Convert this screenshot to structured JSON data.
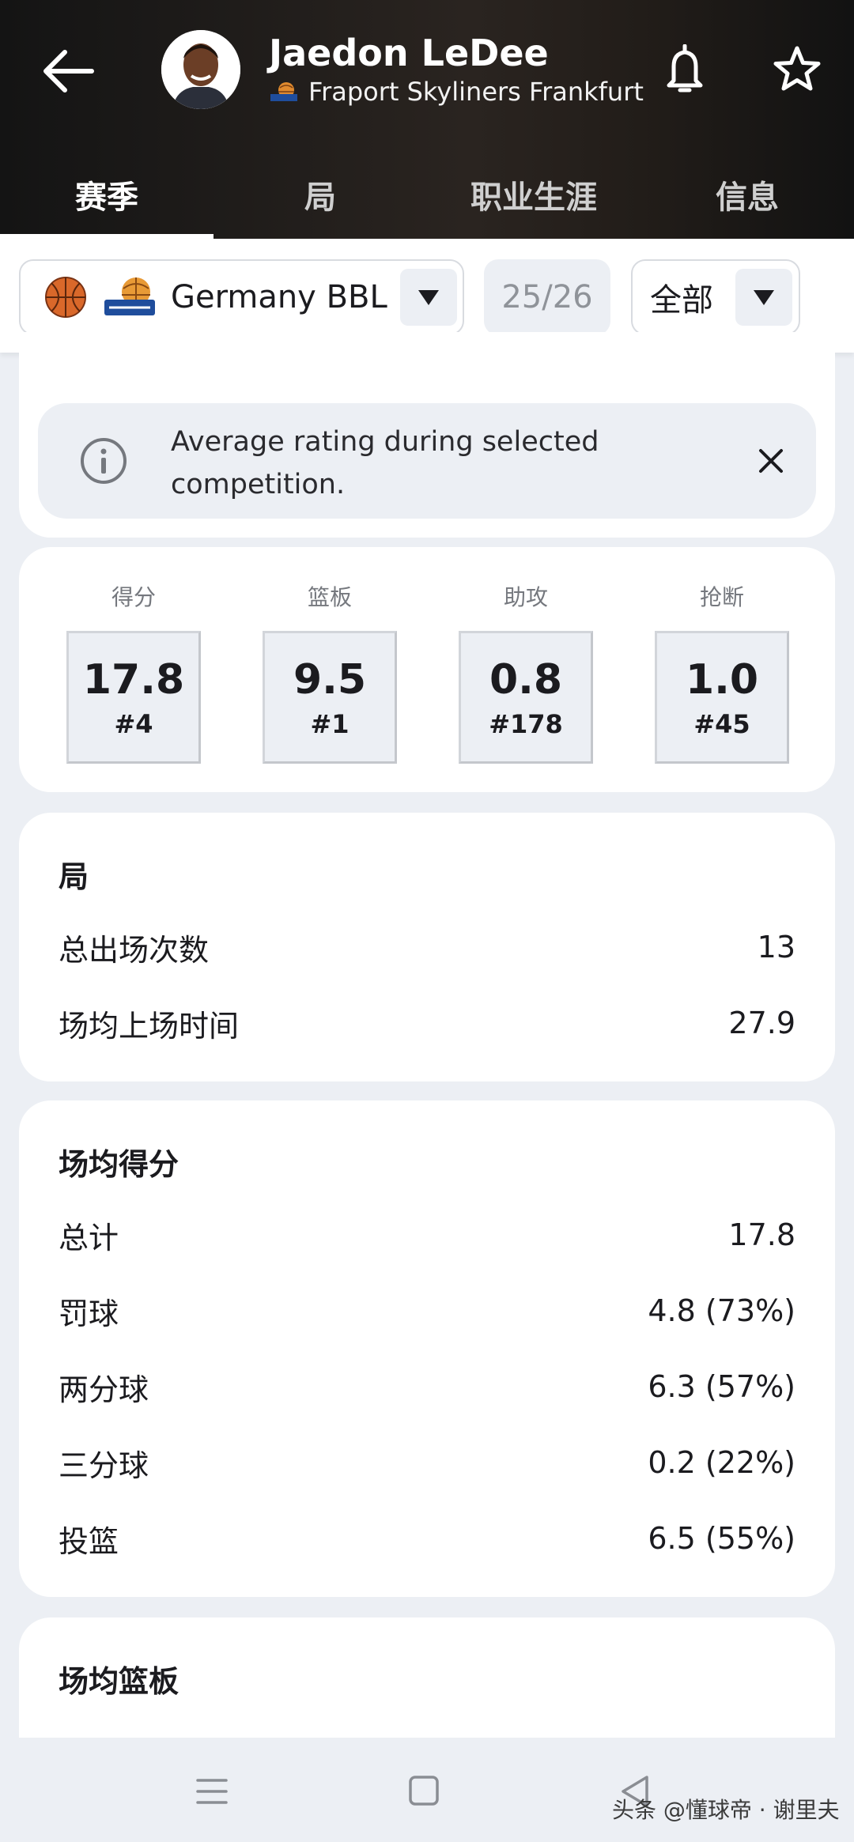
{
  "header": {
    "player_name": "Jaedon LeDee",
    "team_name": "Fraport Skyliners Frankfurt"
  },
  "tabs": [
    {
      "label": "赛季"
    },
    {
      "label": "局"
    },
    {
      "label": "职业生涯"
    },
    {
      "label": "信息"
    }
  ],
  "filters": {
    "competition": "Germany BBL",
    "season": "25/26",
    "scope": "全部"
  },
  "info_banner": {
    "text": "Average rating during selected competition."
  },
  "key_stats": [
    {
      "label": "得分",
      "value": "17.8",
      "rank": "#4"
    },
    {
      "label": "篮板",
      "value": "9.5",
      "rank": "#1"
    },
    {
      "label": "助攻",
      "value": "0.8",
      "rank": "#178"
    },
    {
      "label": "抢断",
      "value": "1.0",
      "rank": "#45"
    }
  ],
  "games_section": {
    "title": "局",
    "rows": [
      {
        "label": "总出场次数",
        "value": "13"
      },
      {
        "label": "场均上场时间",
        "value": "27.9"
      }
    ]
  },
  "scoring_section": {
    "title": "场均得分",
    "rows": [
      {
        "label": "总计",
        "value": "17.8"
      },
      {
        "label": "罚球",
        "value": "4.8 (73%)"
      },
      {
        "label": "两分球",
        "value": "6.3 (57%)"
      },
      {
        "label": "三分球",
        "value": "0.2 (22%)"
      },
      {
        "label": "投篮",
        "value": "6.5 (55%)"
      }
    ]
  },
  "rebounds_section": {
    "title": "场均篮板"
  },
  "watermark": "头条 @懂球帝 · 谢里夫",
  "colors": {
    "header_bg": "#1c1a18",
    "page_bg": "#eceff4",
    "card_bg": "#ffffff",
    "accent_orange": "#d9682a"
  }
}
